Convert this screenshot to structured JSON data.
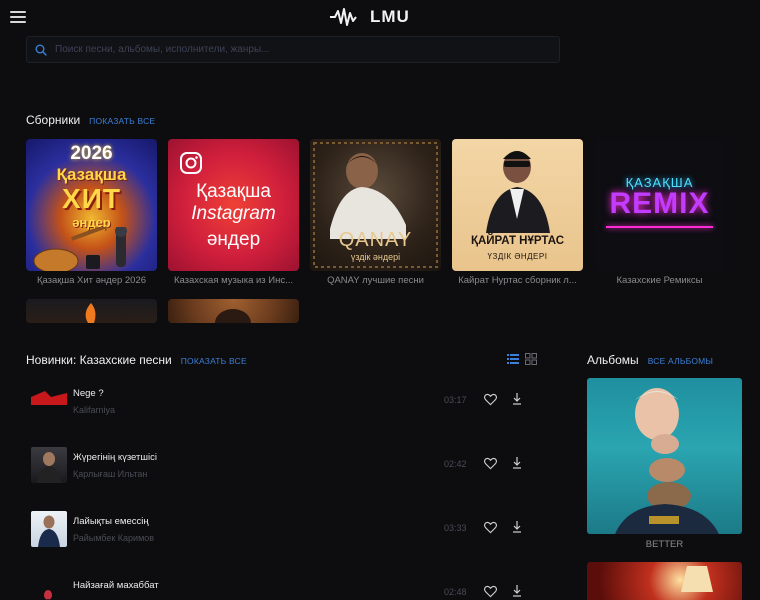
{
  "header": {
    "logo_text": "LMU"
  },
  "search": {
    "placeholder": "Поиск песни, альбомы, исполнители, жанры..."
  },
  "collections": {
    "title": "Сборники",
    "link": "ПОКАЗАТЬ ВСЕ",
    "items": [
      {
        "caption": "Қазақша Хит әндер 2026",
        "cover_lines": [
          "2026",
          "Қазақша",
          "ХИТ",
          "әндер"
        ]
      },
      {
        "caption": "Казахская музыка из Инс...",
        "cover_lines": [
          "Қазақша",
          "Instagram",
          "әндер"
        ]
      },
      {
        "caption": "QANAY лучшие песни",
        "cover_lines": [
          "QANAY",
          "үздік әндері"
        ]
      },
      {
        "caption": "Кайрат Нуртас сборник л...",
        "cover_lines": [
          "ҚАЙРАТ НҰРТАС",
          "ҮЗДІК ӘНДЕРІ"
        ]
      },
      {
        "caption": "Казахские Ремиксы",
        "cover_lines": [
          "ҚАЗАҚША",
          "REMIX"
        ]
      }
    ]
  },
  "new_releases": {
    "title": "Новинки: Казахские песни",
    "link": "ПОКАЗАТЬ ВСЕ",
    "tracks": [
      {
        "title": "Nege ?",
        "artist": "Kalifarniya",
        "time": "03:17"
      },
      {
        "title": "Жүрегінің күзетшісі",
        "artist": "Қарлығаш Ильтан",
        "time": "02:42"
      },
      {
        "title": "Лайықты емессің",
        "artist": "Райымбек Каримов",
        "time": "03:33"
      },
      {
        "title": "Найзағай махаббат",
        "artist": "",
        "time": "02:48"
      }
    ]
  },
  "albums": {
    "title": "Альбомы",
    "link": "ВСЕ АЛЬБОМЫ",
    "items": [
      {
        "caption": "BETTER"
      }
    ]
  },
  "colors": {
    "accent": "#3b7fd6",
    "background": "#0d0d0f"
  }
}
